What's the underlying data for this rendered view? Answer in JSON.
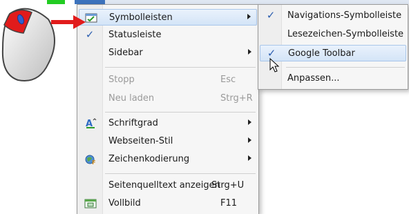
{
  "colors": {
    "menu_bg": "#f6f6f6",
    "highlight": "#d3e4f7",
    "check": "#2d5fb0",
    "menubar_active": "#3d73bd",
    "arrow_red": "#e11b1b",
    "green_marker": "#22cc22"
  },
  "main_menu": {
    "items": [
      {
        "label": "Symbolleisten",
        "has_submenu": true,
        "highlighted": true,
        "icon": "toolbar-icon"
      },
      {
        "label": "Statusleiste",
        "checked": true
      },
      {
        "label": "Sidebar",
        "has_submenu": true
      },
      {
        "label": "Stopp",
        "shortcut": "Esc",
        "disabled": true
      },
      {
        "label": "Neu laden",
        "shortcut": "Strg+R",
        "disabled": true
      },
      {
        "label": "Schriftgrad",
        "has_submenu": true,
        "icon": "font-size-icon"
      },
      {
        "label": "Webseiten-Stil",
        "has_submenu": true
      },
      {
        "label": "Zeichenkodierung",
        "has_submenu": true,
        "icon": "encoding-globe-icon"
      },
      {
        "label": "Seitenquelltext anzeigen",
        "shortcut": "Strg+U"
      },
      {
        "label": "Vollbild",
        "shortcut": "F11",
        "icon": "fullscreen-icon"
      }
    ]
  },
  "sub_menu": {
    "items": [
      {
        "label": "Navigations-Symbolleiste",
        "checked": true
      },
      {
        "label": "Lesezeichen-Symbolleiste"
      },
      {
        "label": "Google Toolbar",
        "checked": true,
        "highlighted": true
      },
      {
        "label": "Anpassen..."
      }
    ]
  },
  "icons": [
    "mouse-icon",
    "red-arrow-icon",
    "cursor-icon",
    "check-icon",
    "submenu-arrow-icon"
  ]
}
